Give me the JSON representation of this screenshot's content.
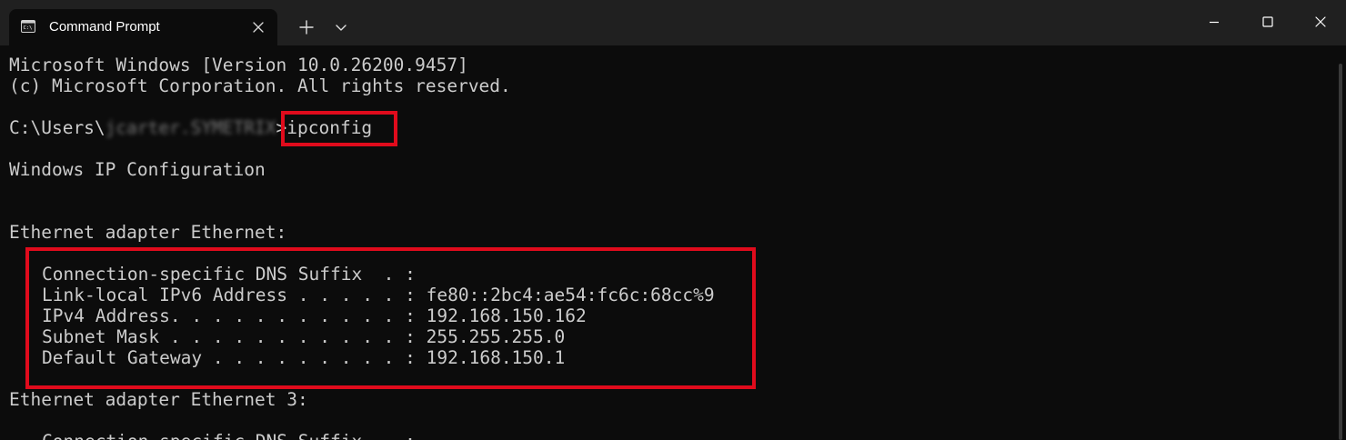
{
  "window": {
    "tab_title": "Command Prompt",
    "icons": {
      "tab": "terminal-icon",
      "close_tab": "close-icon",
      "new_tab": "plus-icon",
      "dropdown": "chevron-down-icon",
      "minimize": "minimize-icon",
      "maximize": "maximize-icon",
      "close_window": "close-icon"
    }
  },
  "console": {
    "version_line": "Microsoft Windows [Version 10.0.26200.9457]",
    "copyright_line": "(c) Microsoft Corporation. All rights reserved.",
    "prompt_prefix": "C:\\Users\\",
    "prompt_user": "jcarter.SYMETRIX",
    "prompt_command": ">ipconfig",
    "ip_config_heading": "Windows IP Configuration",
    "adapters": [
      {
        "header": "Ethernet adapter Ethernet:",
        "rows": [
          "Connection-specific DNS Suffix  . :",
          "Link-local IPv6 Address . . . . . : fe80::2bc4:ae54:fc6c:68cc%9",
          "IPv4 Address. . . . . . . . . . . : 192.168.150.162",
          "Subnet Mask . . . . . . . . . . . : 255.255.255.0",
          "Default Gateway . . . . . . . . . : 192.168.150.1"
        ]
      },
      {
        "header": "Ethernet adapter Ethernet 3:",
        "rows": [
          "Connection-specific DNS Suffix  . :"
        ]
      }
    ]
  },
  "colors": {
    "background": "#0c0c0c",
    "titlebar": "#202020",
    "text": "#cccccc",
    "highlight": "#e00b1c"
  }
}
